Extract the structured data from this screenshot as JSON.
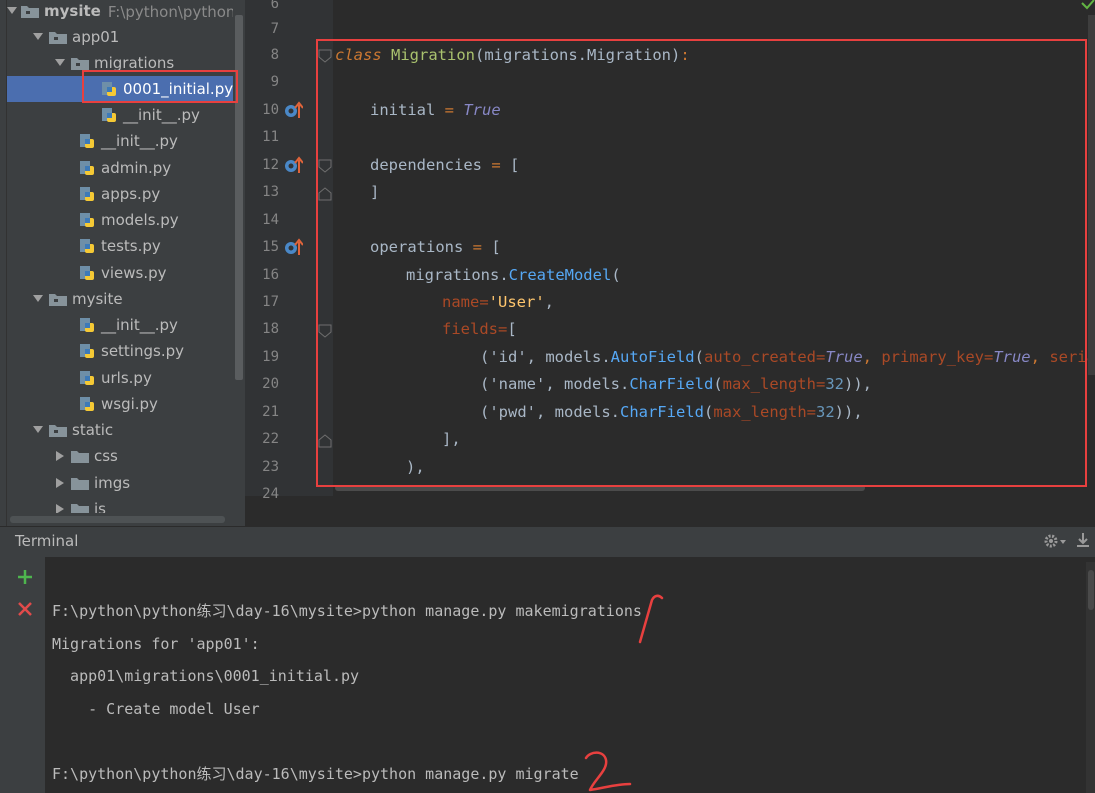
{
  "project_tree": {
    "root": {
      "label": "mysite",
      "path": "F:\\python\\python练"
    },
    "items": [
      {
        "label": "app01",
        "type": "folder",
        "expanded": true
      },
      {
        "label": "migrations",
        "type": "folder",
        "expanded": true
      },
      {
        "label": "0001_initial.py",
        "type": "py",
        "selected": true
      },
      {
        "label": "__init__.py",
        "type": "py"
      },
      {
        "label": "__init__.py",
        "type": "py"
      },
      {
        "label": "admin.py",
        "type": "py"
      },
      {
        "label": "apps.py",
        "type": "py"
      },
      {
        "label": "models.py",
        "type": "py"
      },
      {
        "label": "tests.py",
        "type": "py"
      },
      {
        "label": "views.py",
        "type": "py"
      },
      {
        "label": "mysite",
        "type": "folder",
        "expanded": true
      },
      {
        "label": "__init__.py",
        "type": "py"
      },
      {
        "label": "settings.py",
        "type": "py"
      },
      {
        "label": "urls.py",
        "type": "py"
      },
      {
        "label": "wsgi.py",
        "type": "py"
      },
      {
        "label": "static",
        "type": "folder",
        "expanded": true
      },
      {
        "label": "css",
        "type": "folder",
        "expanded": false
      },
      {
        "label": "imgs",
        "type": "folder",
        "expanded": false
      },
      {
        "label": "js",
        "type": "folder",
        "expanded": false
      }
    ]
  },
  "editor": {
    "line_numbers": [
      "6",
      "7",
      "8",
      "9",
      "10",
      "11",
      "12",
      "13",
      "14",
      "15",
      "16",
      "17",
      "18",
      "19",
      "20",
      "21",
      "22",
      "23",
      "24"
    ],
    "code": {
      "l8_kw": "class",
      "l8_name": "Migration",
      "l8_rest": "(migrations.Migration)",
      "l8_colon": ":",
      "l10_a": "initial",
      "l10_op": " = ",
      "l10_val": "True",
      "l12_a": "dependencies",
      "l12_op": " = ",
      "l12_b": "[",
      "l13": "]",
      "l15_a": "operations",
      "l15_op": " = ",
      "l15_b": "[",
      "l16_a": "migrations.",
      "l16_fn": "CreateModel",
      "l16_b": "(",
      "l17_kw": "name=",
      "l17_str": "'User'",
      "l17_c": ",",
      "l18_kw": "fields=",
      "l18_b": "[",
      "l19_a": "('id', models.",
      "l19_fn": "AutoField",
      "l19_p": "(",
      "l19_k1": "auto_created=",
      "l19_v1": "True",
      "l19_s": ", ",
      "l19_k2": "primary_key=",
      "l19_v2": "True",
      "l19_s2": ", ",
      "l19_k3": "serializ",
      "l20_a": "('name', models.",
      "l20_fn": "CharField",
      "l20_p": "(",
      "l20_k": "max_length=",
      "l20_v": "32",
      "l20_e": ")),",
      "l21_a": "('pwd', models.",
      "l21_fn": "CharField",
      "l21_p": "(",
      "l21_k": "max_length=",
      "l21_v": "32",
      "l21_e": ")),",
      "l22": "],",
      "l23": "),"
    }
  },
  "terminal": {
    "title": "Terminal",
    "lines": [
      "F:\\python\\python练习\\day-16\\mysite>python manage.py makemigrations",
      "Migrations for 'app01':",
      "  app01\\migrations\\0001_initial.py",
      "    - Create model User",
      "",
      "F:\\python\\python练习\\day-16\\mysite>python manage.py migrate"
    ]
  },
  "colors": {
    "accent_red": "#e8403f",
    "selection": "#4b6eaf"
  }
}
